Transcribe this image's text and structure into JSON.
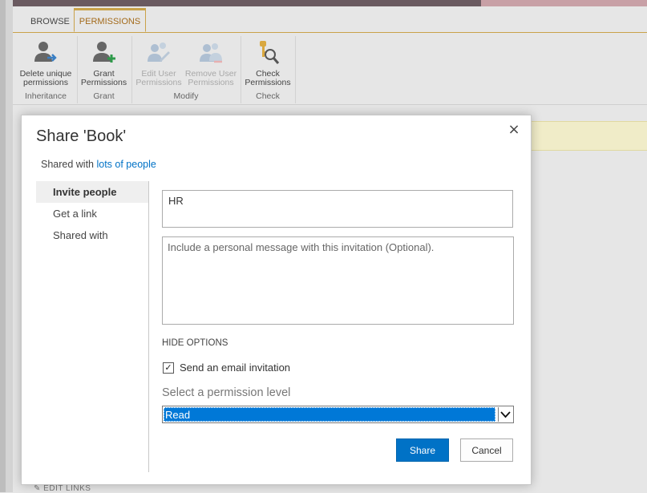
{
  "ribbon": {
    "tabs": [
      {
        "label": "BROWSE",
        "active": false
      },
      {
        "label": "PERMISSIONS",
        "active": true
      }
    ],
    "buttons": [
      {
        "label1": "Delete unique",
        "label2": "permissions",
        "icon": "user-delete-icon",
        "enabled": true
      },
      {
        "label1": "Grant",
        "label2": "Permissions",
        "icon": "user-add-icon",
        "enabled": true
      },
      {
        "label1": "Edit User",
        "label2": "Permissions",
        "icon": "user-edit-icon",
        "enabled": false
      },
      {
        "label1": "Remove User",
        "label2": "Permissions",
        "icon": "users-remove-icon",
        "enabled": false
      },
      {
        "label1": "Check",
        "label2": "Permissions",
        "icon": "key-search-icon",
        "enabled": true
      }
    ],
    "groups": [
      "Inheritance",
      "Grant",
      "Modify",
      "Check"
    ]
  },
  "dialog": {
    "title": "Share 'Book'",
    "close_icon": "×",
    "shared_prefix": "Shared with ",
    "shared_link": "lots of people",
    "nav": [
      "Invite people",
      "Get a link",
      "Shared with"
    ],
    "invite_value": "HR",
    "message_placeholder": "Include a personal message with this invitation (Optional).",
    "hide_options": "HIDE OPTIONS",
    "send_email_label": "Send an email invitation",
    "send_email_checked": true,
    "permission_label": "Select a permission level",
    "permission_value": "Read",
    "share_button": "Share",
    "cancel_button": "Cancel"
  },
  "footer": {
    "edit_links": "EDIT LINKS"
  },
  "colors": {
    "accent": "#0072c6",
    "ribbon_tab_accent": "#c9a24a",
    "selection": "#0078d7"
  }
}
